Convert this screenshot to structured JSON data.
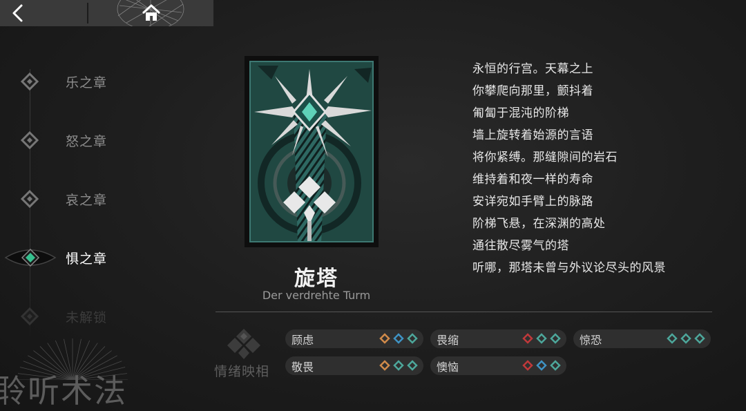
{
  "nav": {
    "back_icon": "chevron-left-icon",
    "home_icon": "home-icon"
  },
  "sidebar": {
    "items": [
      {
        "label": "乐之章",
        "state": "normal"
      },
      {
        "label": "怒之章",
        "state": "normal"
      },
      {
        "label": "哀之章",
        "state": "normal"
      },
      {
        "label": "惧之章",
        "state": "active"
      },
      {
        "label": "未解锁",
        "state": "locked"
      }
    ]
  },
  "watermark": "聆听术法",
  "card": {
    "title": "旋塔",
    "subtitle": "Der verdrehte Turm"
  },
  "poem": {
    "lines": [
      "永恒的行宫。天幕之上",
      "你攀爬向那里，颤抖着",
      "匍匐于混沌的阶梯",
      "墙上旋转着始源的言语",
      "将你紧缚。那缝隙间的岩石",
      "维持着和夜一样的寿命",
      "安详宛如手臂上的脉路",
      "阶梯飞悬，在深渊的高处",
      "通往散尽雾气的塔",
      "听哪，那塔未曾与外议论尽头的风景"
    ]
  },
  "emotion": {
    "label": "情绪映相",
    "icon": "emotion-diamond-icon",
    "colors": {
      "orange": "#d08a4a",
      "blue": "#3f93c4",
      "teal": "#4da79b",
      "red": "#c0393a"
    },
    "items": [
      {
        "name": "顾虑",
        "gems": [
          "orange",
          "blue",
          "teal"
        ]
      },
      {
        "name": "畏缩",
        "gems": [
          "red",
          "teal",
          "teal"
        ]
      },
      {
        "name": "惊恐",
        "gems": [
          "teal",
          "teal",
          "teal"
        ]
      },
      {
        "name": "敬畏",
        "gems": [
          "orange",
          "teal",
          "teal"
        ]
      },
      {
        "name": "懊恼",
        "gems": [
          "red",
          "blue",
          "teal"
        ]
      }
    ]
  }
}
